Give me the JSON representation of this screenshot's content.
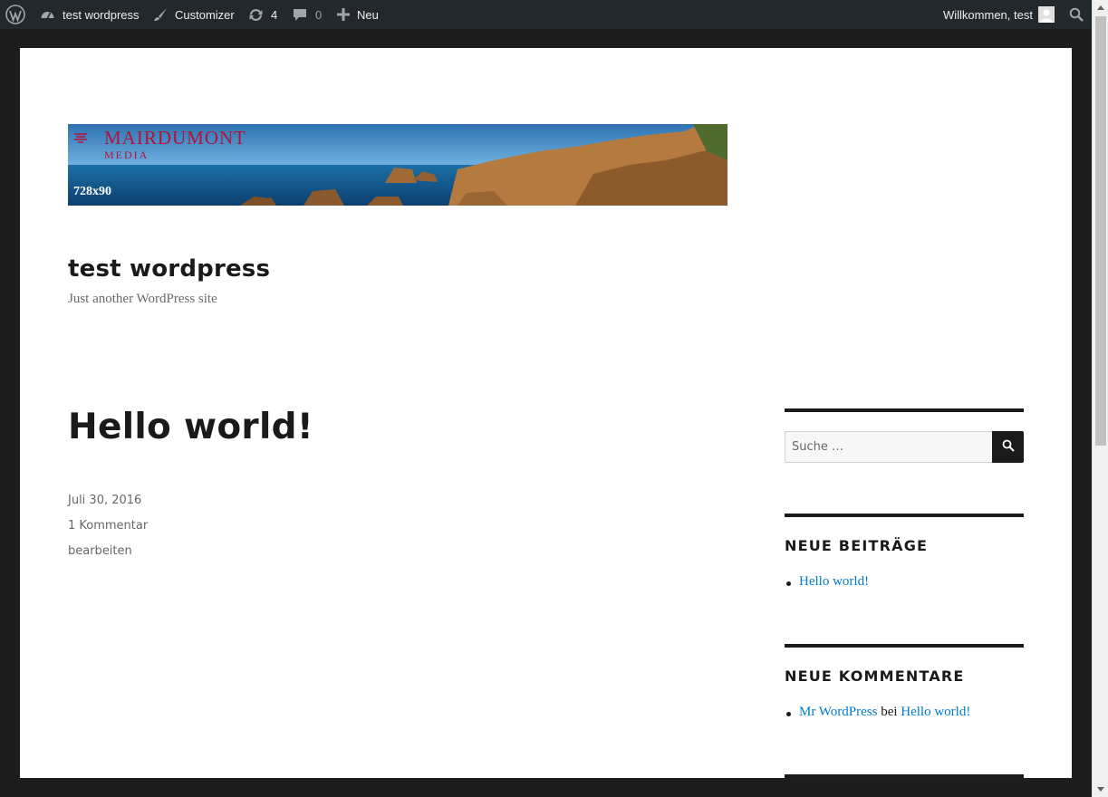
{
  "adminbar": {
    "site_name": "test wordpress",
    "customizer": "Customizer",
    "updates_count": "4",
    "comments_count": "0",
    "new_label": "Neu",
    "welcome": "Willkommen, test"
  },
  "banner": {
    "brand": "MAIRDUMONT",
    "brand_sub": "MEDIA",
    "size_label": "728x90"
  },
  "site": {
    "title": "test wordpress",
    "description": "Just another WordPress site"
  },
  "post": {
    "title": "Hello world!",
    "date": "Juli 30, 2016",
    "comments": "1 Kommentar",
    "edit": "bearbeiten"
  },
  "sidebar": {
    "search_placeholder": "Suche …",
    "recent_posts_title": "NEUE BEITRÄGE",
    "recent_posts": [
      "Hello world!"
    ],
    "recent_comments_title": "NEUE KOMMENTARE",
    "recent_comment": {
      "author": "Mr WordPress",
      "connector": "bei",
      "post": "Hello world!"
    }
  },
  "colors": {
    "adminbar_bg": "#23282d",
    "link": "#007acc",
    "text": "#1a1a1a",
    "brand_red": "#b3123a"
  }
}
